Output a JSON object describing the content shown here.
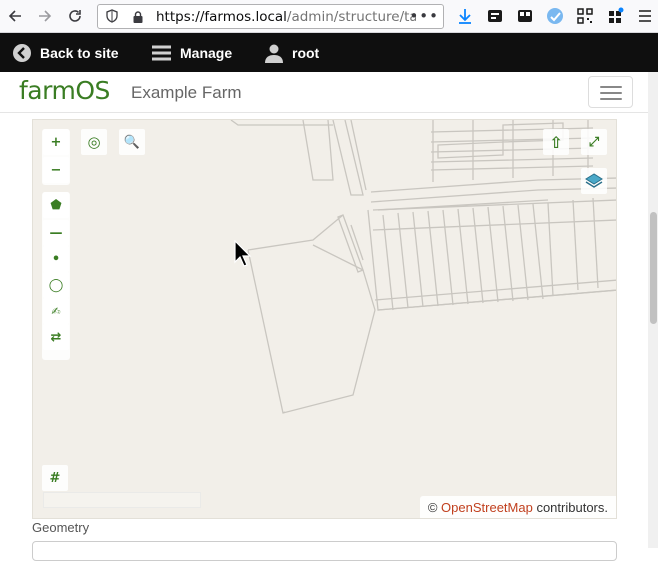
{
  "browser": {
    "url_host": "https://farmos.local",
    "url_path": "/admin/structure/tax",
    "more_label": "•••"
  },
  "toolbar": {
    "back_label": "Back to site",
    "manage_label": "Manage",
    "user_label": "root"
  },
  "header": {
    "logo_text": "farmOS",
    "site_name": "Example Farm"
  },
  "map": {
    "controls": {
      "zoom_in": "+",
      "zoom_out": "−",
      "geolocate": "◎",
      "search": "🔍",
      "upload": "⇧",
      "fullscreen": "⤢",
      "draw_polygon": "⬟",
      "draw_line": "—",
      "draw_point": "•",
      "draw_circle": "◯",
      "modify": "✍",
      "move": "⇄",
      "snap_grid": "#"
    },
    "attribution_prefix": "©",
    "attribution_link": "OpenStreetMap",
    "attribution_suffix": "contributors."
  },
  "form": {
    "geometry_label": "Geometry"
  },
  "colors": {
    "brand_green": "#3a7d23",
    "toolbar_bg": "#0f0f0f",
    "map_bg": "#f2efe9",
    "osm_link": "#c1401e"
  }
}
